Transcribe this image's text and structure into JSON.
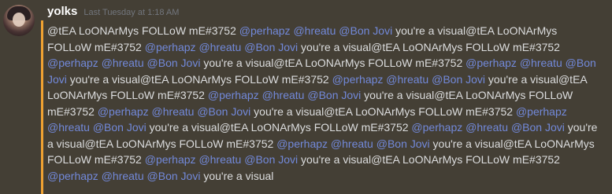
{
  "message": {
    "username": "yolks",
    "timestamp": "Last Tuesday at 1:18 AM",
    "segments": [
      {
        "text": "@tEA LoONArMys FOLLoW mE#3752 ",
        "type": "text"
      },
      {
        "text": "@perhapz",
        "type": "mention"
      },
      {
        "text": " ",
        "type": "text"
      },
      {
        "text": "@hreatu",
        "type": "mention"
      },
      {
        "text": " ",
        "type": "text"
      },
      {
        "text": "@Bon Jovi",
        "type": "mention"
      },
      {
        "text": " you're a visual@tEA LoONArMys FOLLoW mE#3752 ",
        "type": "text"
      },
      {
        "text": "@perhapz",
        "type": "mention"
      },
      {
        "text": " ",
        "type": "text"
      },
      {
        "text": "@hreatu",
        "type": "mention"
      },
      {
        "text": " ",
        "type": "text"
      },
      {
        "text": "@Bon Jovi",
        "type": "mention"
      },
      {
        "text": " you're a visual@tEA LoONArMys FOLLoW mE#3752 ",
        "type": "text"
      },
      {
        "text": "@perhapz",
        "type": "mention"
      },
      {
        "text": " ",
        "type": "text"
      },
      {
        "text": "@hreatu",
        "type": "mention"
      },
      {
        "text": " ",
        "type": "text"
      },
      {
        "text": "@Bon Jovi",
        "type": "mention"
      },
      {
        "text": " you're a visual@tEA LoONArMys FOLLoW mE#3752 ",
        "type": "text"
      },
      {
        "text": "@perhapz",
        "type": "mention"
      },
      {
        "text": " ",
        "type": "text"
      },
      {
        "text": "@hreatu",
        "type": "mention"
      },
      {
        "text": " ",
        "type": "text"
      },
      {
        "text": "@Bon Jovi",
        "type": "mention"
      },
      {
        "text": " you're a visual@tEA LoONArMys FOLLoW mE#3752 ",
        "type": "text"
      },
      {
        "text": "@perhapz",
        "type": "mention"
      },
      {
        "text": " ",
        "type": "text"
      },
      {
        "text": "@hreatu",
        "type": "mention"
      },
      {
        "text": " ",
        "type": "text"
      },
      {
        "text": "@Bon Jovi",
        "type": "mention"
      },
      {
        "text": " you're a visual@tEA LoONArMys FOLLoW mE#3752 ",
        "type": "text"
      },
      {
        "text": "@perhapz",
        "type": "mention"
      },
      {
        "text": " ",
        "type": "text"
      },
      {
        "text": "@hreatu",
        "type": "mention"
      },
      {
        "text": " ",
        "type": "text"
      },
      {
        "text": "@Bon Jovi",
        "type": "mention"
      },
      {
        "text": " you're a visual@tEA LoONArMys FOLLoW mE#3752 ",
        "type": "text"
      },
      {
        "text": "@perhapz",
        "type": "mention"
      },
      {
        "text": " ",
        "type": "text"
      },
      {
        "text": "@hreatu",
        "type": "mention"
      },
      {
        "text": " ",
        "type": "text"
      },
      {
        "text": "@Bon Jovi",
        "type": "mention"
      },
      {
        "text": " you're a visual@tEA LoONArMys FOLLoW mE#3752 ",
        "type": "text"
      },
      {
        "text": "@perhapz",
        "type": "mention"
      },
      {
        "text": " ",
        "type": "text"
      },
      {
        "text": "@hreatu",
        "type": "mention"
      },
      {
        "text": " ",
        "type": "text"
      },
      {
        "text": "@Bon Jovi",
        "type": "mention"
      },
      {
        "text": " you're a visual@tEA LoONArMys FOLLoW mE#3752 ",
        "type": "text"
      },
      {
        "text": "@perhapz",
        "type": "mention"
      },
      {
        "text": " ",
        "type": "text"
      },
      {
        "text": "@hreatu",
        "type": "mention"
      },
      {
        "text": " ",
        "type": "text"
      },
      {
        "text": "@Bon Jovi",
        "type": "mention"
      },
      {
        "text": " you're a visual@tEA LoONArMys FOLLoW mE#3752 ",
        "type": "text"
      },
      {
        "text": "@perhapz",
        "type": "mention"
      },
      {
        "text": " ",
        "type": "text"
      },
      {
        "text": "@hreatu",
        "type": "mention"
      },
      {
        "text": " ",
        "type": "text"
      },
      {
        "text": "@Bon Jovi",
        "type": "mention"
      },
      {
        "text": " you're a visual@tEA LoONArMys FOLLoW mE#3752 ",
        "type": "text"
      },
      {
        "text": "@perhapz",
        "type": "mention"
      },
      {
        "text": " ",
        "type": "text"
      },
      {
        "text": "@hreatu",
        "type": "mention"
      },
      {
        "text": " ",
        "type": "text"
      },
      {
        "text": "@Bon Jovi",
        "type": "mention"
      },
      {
        "text": " you're a visual@tEA LoONArMys FOLLoW mE#3752 ",
        "type": "text"
      },
      {
        "text": "@perhapz",
        "type": "mention"
      },
      {
        "text": " ",
        "type": "text"
      },
      {
        "text": "@hreatu",
        "type": "mention"
      },
      {
        "text": " ",
        "type": "text"
      },
      {
        "text": "@Bon Jovi",
        "type": "mention"
      },
      {
        "text": " you're a visual",
        "type": "text"
      }
    ]
  },
  "colors": {
    "background": "#36393f",
    "mention_highlight_background": "#443f35",
    "accent_bar": "#f0a232",
    "username": "#ffffff",
    "timestamp": "#72767d",
    "text": "#dcddde",
    "mention": "#7289da"
  }
}
